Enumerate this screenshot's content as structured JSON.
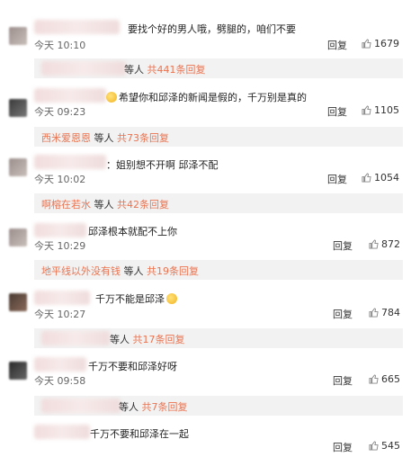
{
  "comments": [
    {
      "text": "要找个好的男人哦，劈腿的，咱们不要",
      "time": "今天 10:10",
      "reply": "回复",
      "likes": "1679"
    },
    {
      "text": "希望你和邱泽的新闻是假的，千万别是真的",
      "time": "今天 09:23",
      "reply": "回复",
      "likes": "1105"
    },
    {
      "text": "：姐别想不开啊 邱泽不配",
      "time": "今天 10:02",
      "reply": "回复",
      "likes": "1054"
    },
    {
      "text": "邱泽根本就配不上你",
      "time": "今天 10:29",
      "reply": "回复",
      "likes": "872"
    },
    {
      "text": "千万不能是邱泽",
      "time": "今天 10:27",
      "reply": "回复",
      "likes": "784"
    },
    {
      "text": "千万不要和邱泽好呀",
      "time": "今天 09:58",
      "reply": "回复",
      "likes": "665"
    },
    {
      "text": "千万不要和邱泽在一起",
      "time": "",
      "reply": "回复",
      "likes": "545"
    }
  ],
  "reply_bars": [
    {
      "nick": "",
      "mid": "等人",
      "count": "共441条回复"
    },
    {
      "nick": "西米爱恩恩",
      "mid": "等人",
      "count": "共73条回复"
    },
    {
      "nick": "啊榕在若水",
      "mid": "等人",
      "count": "共42条回复"
    },
    {
      "nick": "地平线以外没有钱",
      "mid": "等人",
      "count": "共19条回复"
    },
    {
      "nick": "",
      "mid": "等人",
      "count": "共17条回复"
    },
    {
      "nick": "",
      "mid": "等人",
      "count": "共7条回复"
    }
  ],
  "icons": {
    "like": "thumbs-up-icon",
    "emoji": "smiley-icon"
  },
  "colors": {
    "accent": "#eb7350",
    "bar_bg": "#f2f2f2"
  }
}
